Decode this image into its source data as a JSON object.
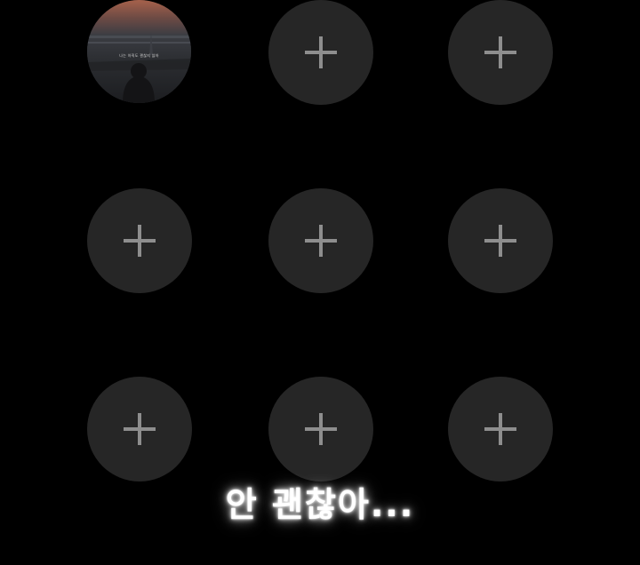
{
  "story_grid": {
    "filled_slot": {
      "caption": "나는 아직도 괜찮지 않아"
    },
    "empty_slot_icon": "plus-icon",
    "empty_slot_count": 8
  },
  "subtitle": "안 괜찮아...",
  "colors": {
    "background": "#000000",
    "slot_fill": "#262626",
    "plus_icon": "#8e8e8e",
    "subtitle_text": "#ffffff"
  }
}
